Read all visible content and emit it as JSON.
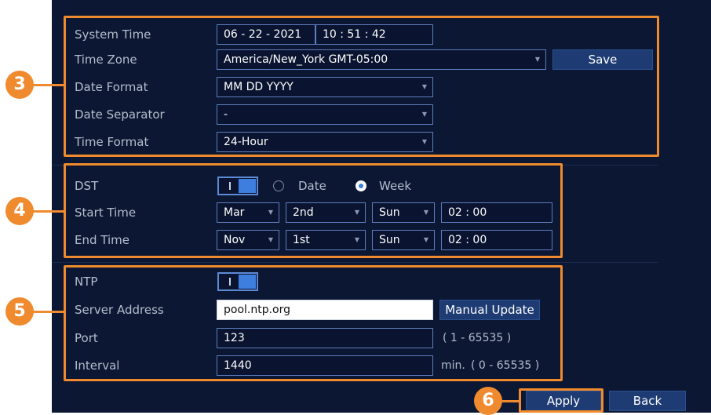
{
  "time_section": {
    "system_time_label": "System Time",
    "date_value": "06 - 22 - 2021",
    "time_value": "10 : 51 : 42",
    "time_zone_label": "Time Zone",
    "time_zone_value": "America/New_York GMT-05:00",
    "save_label": "Save",
    "date_format_label": "Date Format",
    "date_format_value": "MM DD YYYY",
    "date_separator_label": "Date Separator",
    "date_separator_value": "-",
    "time_format_label": "Time Format",
    "time_format_value": "24-Hour"
  },
  "dst_section": {
    "dst_label": "DST",
    "dst_enabled": true,
    "mode_date_label": "Date",
    "mode_week_label": "Week",
    "selected_mode": "Week",
    "start_time_label": "Start Time",
    "start": {
      "month": "Mar",
      "week": "2nd",
      "day": "Sun",
      "time": "02 : 00"
    },
    "end_time_label": "End Time",
    "end": {
      "month": "Nov",
      "week": "1st",
      "day": "Sun",
      "time": "02 : 00"
    }
  },
  "ntp_section": {
    "ntp_label": "NTP",
    "ntp_enabled": true,
    "server_address_label": "Server Address",
    "server_address_value": "pool.ntp.org",
    "manual_update_label": "Manual Update",
    "port_label": "Port",
    "port_value": "123",
    "port_range": "( 1 - 65535 )",
    "interval_label": "Interval",
    "interval_value": "1440",
    "interval_unit": "min.",
    "interval_range": "( 0 - 65535 )"
  },
  "footer": {
    "apply_label": "Apply",
    "back_label": "Back"
  },
  "callouts": {
    "badge_3": "3",
    "badge_4": "4",
    "badge_5": "5",
    "badge_6": "6"
  },
  "colors": {
    "background": "#0c1733",
    "callout": "#ef8a2e",
    "field_border": "#5e7dbf",
    "button": "#1e3c73",
    "toggle_on": "#3d7ede"
  },
  "icons": {
    "dropdown": "chevron-down-icon",
    "toggle": "toggle-switch-icon",
    "radio": "radio-button-icon"
  }
}
